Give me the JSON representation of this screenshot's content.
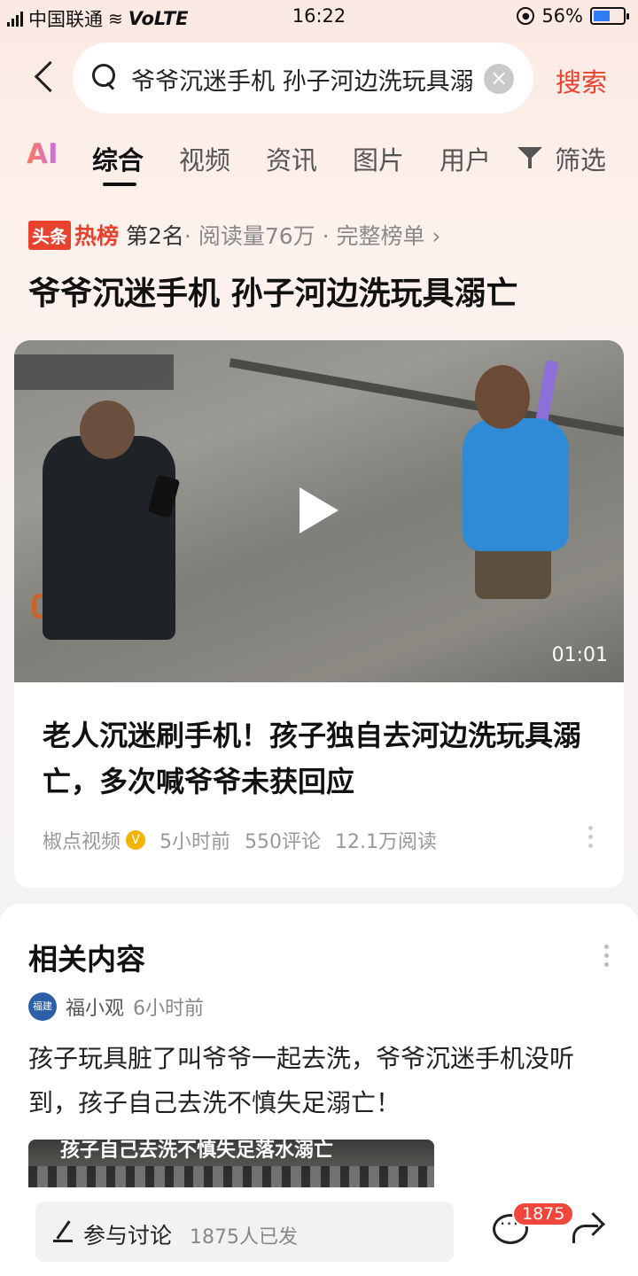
{
  "status_bar": {
    "carrier": "中国联通",
    "network": "VoLTE",
    "time": "16:22",
    "battery": "56%",
    "battery_level": 0.56
  },
  "search": {
    "query": "爷爷沉迷手机 孙子河边洗玩具溺亡",
    "clear_icon": "×",
    "button_label": "搜索"
  },
  "tabs": {
    "ai": "AI",
    "items": [
      "综合",
      "视频",
      "资讯",
      "图片",
      "用户",
      "筛选"
    ],
    "active": "综合"
  },
  "hot_rank": {
    "badge_left": "头条",
    "badge_right": "热榜",
    "rank": "第2名",
    "reads": " · 阅读量76万 · 完整榜单 ›"
  },
  "topic_title": "爷爷沉迷手机 孙子河边洗玩具溺亡",
  "video_card": {
    "duration": "01:01",
    "title": "老人沉迷刷手机！孩子独自去河边洗玩具溺亡，多次喊爷爷未获回应",
    "source": "椒点视频",
    "time": "5小时前",
    "comments": "550评论",
    "reads": "12.1万阅读"
  },
  "related": {
    "section_title": "相关内容",
    "author_avatar_text": "福建",
    "author": "福小观",
    "time": "6小时前",
    "text": "孩子玩具脏了叫爷爷一起去洗，爷爷沉迷手机没听到，孩子自己去洗不慎失足溺亡！",
    "thumb_caption": "孩子自己去洗不慎失足落水溺亡"
  },
  "bottom_bar": {
    "discuss_label": "参与讨论",
    "discuss_count": "1875人已发",
    "comment_badge": "1875"
  },
  "colors": {
    "accent": "#e8412e",
    "badge": "#f0463c",
    "verify": "#f2b400"
  }
}
